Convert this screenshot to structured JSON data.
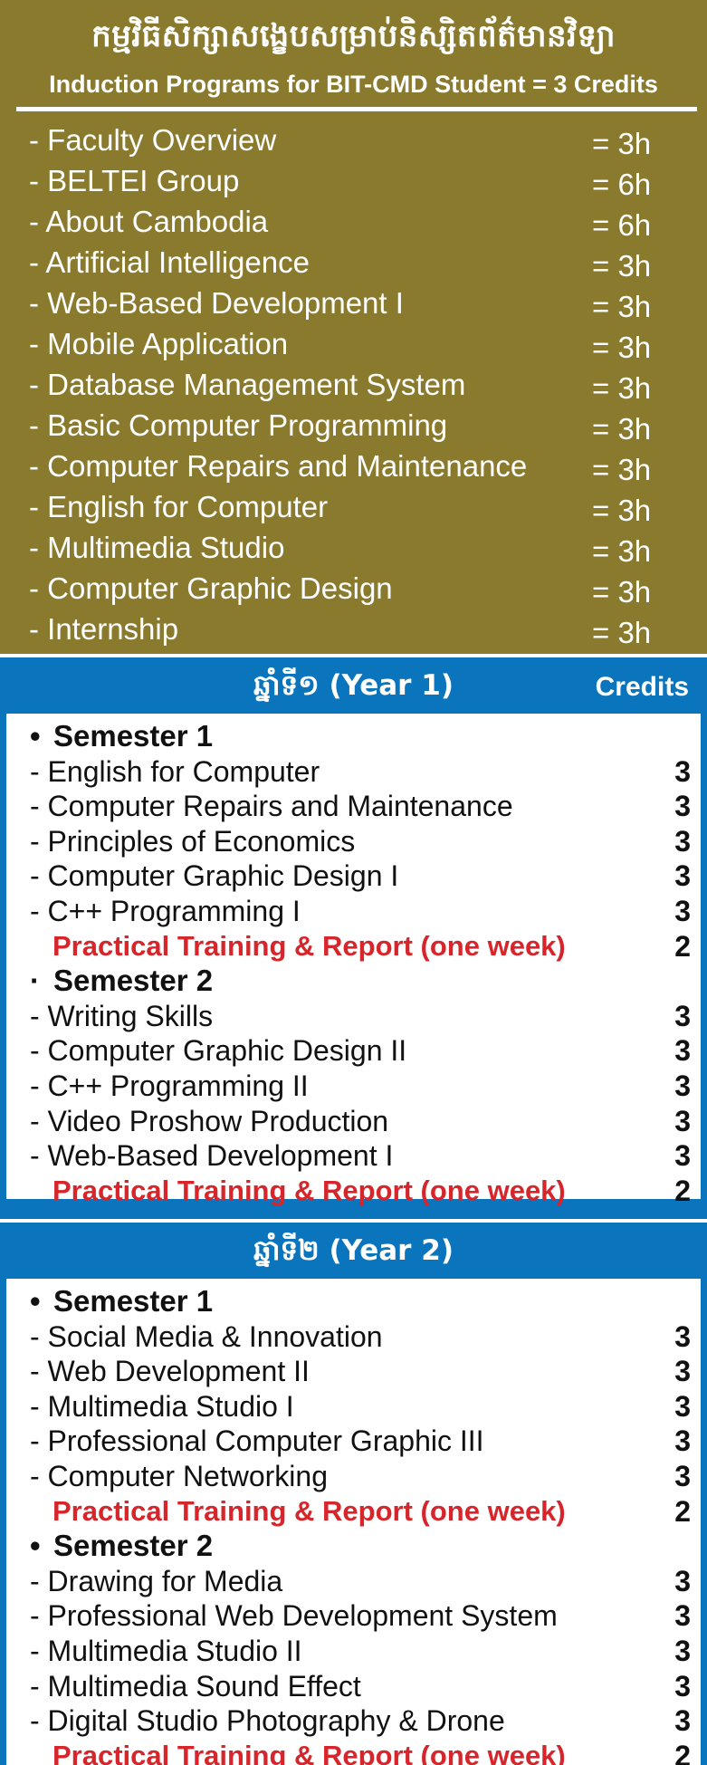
{
  "induction": {
    "khmer_title": "កម្មវិធីសិក្សាសង្ខេបសម្រាប់និស្សិតព័ត៌មានវិទ្យា",
    "title": "Induction Programs for BIT-CMD Student = 3 Credits",
    "items": [
      {
        "name": "- Faculty Overview",
        "hours": "= 3h"
      },
      {
        "name": "- BELTEI Group",
        "hours": "= 6h"
      },
      {
        "name": "- About Cambodia",
        "hours": "= 6h"
      },
      {
        "name": "- Artificial Intelligence",
        "hours": "= 3h"
      },
      {
        "name": "- Web-Based Development I",
        "hours": "= 3h"
      },
      {
        "name": "- Mobile Application",
        "hours": "= 3h"
      },
      {
        "name": "- Database Management System",
        "hours": "= 3h"
      },
      {
        "name": "- Basic Computer Programming",
        "hours": "= 3h"
      },
      {
        "name": "- Computer Repairs and Maintenance",
        "hours": "= 3h"
      },
      {
        "name": "- English for Computer",
        "hours": "= 3h"
      },
      {
        "name": "- Multimedia Studio",
        "hours": "= 3h"
      },
      {
        "name": "- Computer Graphic Design",
        "hours": "= 3h"
      },
      {
        "name": "- Internship",
        "hours": "= 3h"
      }
    ]
  },
  "year1": {
    "title": "ឆ្នាំទី១ (Year 1)",
    "credits_header": "Credits",
    "rows": [
      {
        "kind": "sem",
        "bullet": "•",
        "text": "Semester 1"
      },
      {
        "kind": "course",
        "text": "- English for Computer",
        "credits": "3"
      },
      {
        "kind": "course",
        "text": "- Computer Repairs and Maintenance",
        "credits": "3"
      },
      {
        "kind": "course",
        "text": "- Principles of Economics",
        "credits": "3"
      },
      {
        "kind": "course",
        "text": "- Computer Graphic Design I",
        "credits": "3"
      },
      {
        "kind": "course",
        "text": "- C++ Programming I",
        "credits": "3"
      },
      {
        "kind": "prac",
        "text": "Practical Training & Report (one week)",
        "credits": "2"
      },
      {
        "kind": "sem",
        "bullet": "·",
        "text": "Semester 2"
      },
      {
        "kind": "course",
        "text": "- Writing Skills",
        "credits": "3"
      },
      {
        "kind": "course",
        "text": "- Computer Graphic Design II",
        "credits": "3"
      },
      {
        "kind": "course",
        "text": "- C++ Programming II",
        "credits": "3"
      },
      {
        "kind": "course",
        "text": "- Video Proshow Production",
        "credits": "3"
      },
      {
        "kind": "course",
        "text": "- Web-Based Development I",
        "credits": "3"
      },
      {
        "kind": "prac",
        "text": "Practical Training & Report (one week)",
        "credits": "2"
      }
    ]
  },
  "year2": {
    "title": "ឆ្នាំទី២ (Year 2)",
    "rows": [
      {
        "kind": "sem",
        "bullet": "•",
        "text": "Semester 1"
      },
      {
        "kind": "course",
        "text": "- Social Media & Innovation",
        "credits": "3"
      },
      {
        "kind": "course",
        "text": "- Web Development II",
        "credits": "3"
      },
      {
        "kind": "course",
        "text": "- Multimedia Studio I",
        "credits": "3"
      },
      {
        "kind": "course",
        "text": "- Professional Computer Graphic III",
        "credits": "3"
      },
      {
        "kind": "course",
        "text": "- Computer Networking",
        "credits": "3"
      },
      {
        "kind": "prac",
        "text": "Practical Training & Report (one week)",
        "credits": "2"
      },
      {
        "kind": "sem",
        "bullet": "•",
        "text": "Semester 2"
      },
      {
        "kind": "course",
        "text": "- Drawing for Media",
        "credits": "3"
      },
      {
        "kind": "course",
        "text": "- Professional Web Development System",
        "credits": "3"
      },
      {
        "kind": "course",
        "text": "- Multimedia Studio II",
        "credits": "3"
      },
      {
        "kind": "course",
        "text": "- Multimedia Sound Effect",
        "credits": "3"
      },
      {
        "kind": "course",
        "text": "- Digital Studio Photography & Drone",
        "credits": "3"
      },
      {
        "kind": "prac",
        "text": "Practical Training & Report (one week)",
        "credits": "2"
      }
    ]
  }
}
